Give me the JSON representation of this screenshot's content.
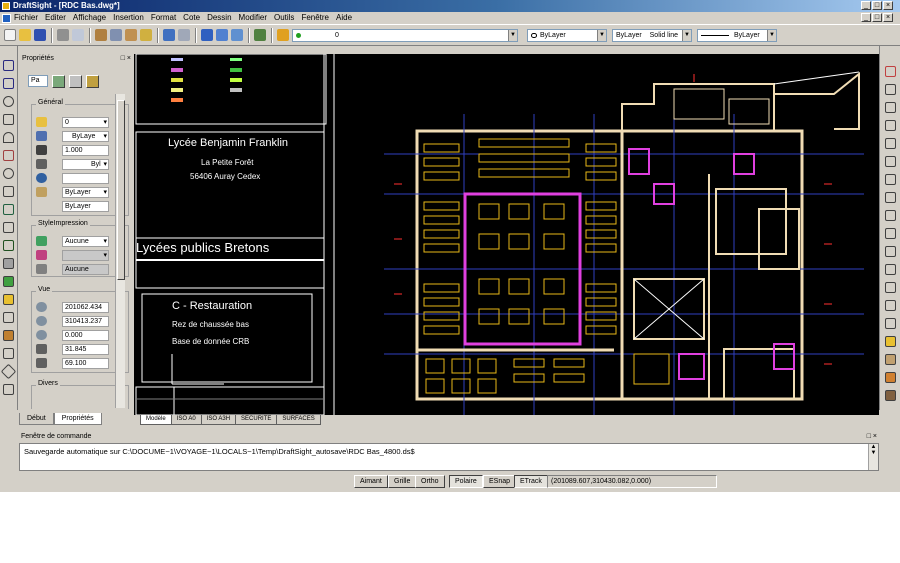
{
  "window": {
    "title": "DraftSight - [RDC Bas.dwg*]",
    "buttons": [
      "_",
      "□",
      "×"
    ],
    "doc_buttons": [
      "_",
      "□",
      "×"
    ]
  },
  "menu": [
    "Fichier",
    "Editer",
    "Affichage",
    "Insertion",
    "Format",
    "Cote",
    "Dessin",
    "Modifier",
    "Outils",
    "Fenêtre",
    "Aide"
  ],
  "toolbar": {
    "layer_value": "0",
    "color_value": "ByLayer",
    "linestyle_value": "ByLayer",
    "linestyle_name": "Solid line",
    "lineweight_value": "ByLayer"
  },
  "properties": {
    "title": "Propriétés",
    "close_btns": "□ ×",
    "select_value": "Pa",
    "general_title": "Général",
    "general": [
      "0",
      "ByLaye",
      "1.000",
      "Byl",
      "",
      "ByLayer",
      "ByLayer"
    ],
    "print_title": "StyleImpression",
    "print": [
      "Aucune",
      "",
      "Aucune"
    ],
    "view_title": "Vue",
    "view": [
      "201062.434",
      "310413.237",
      "0.000",
      "31.845",
      "69.100"
    ],
    "divers_title": "Divers",
    "tabs": [
      "Début",
      "Propriétés"
    ]
  },
  "drawing": {
    "title_block": {
      "school": "Lycée Benjamin Franklin",
      "place": "La Petite Forêt",
      "address": "56406 Auray Cedex",
      "network": "Lycées publics Bretons",
      "section": "C - Restauration",
      "level": "Rez de chaussée bas",
      "database": "Base de donnée CRB"
    },
    "tabs": [
      "Modèle",
      "ISO A0",
      "ISO A3H",
      "SECURITE",
      "SURFACES"
    ]
  },
  "command": {
    "title": "Fenêtre de commande",
    "text": "Sauvegarde automatique sur C:\\DOCUME~1\\VOYAGE~1\\LOCALS~1\\Temp\\DraftSight_autosave\\RDC Bas_4800.ds$",
    "buttons": "□ ×"
  },
  "status": {
    "toggles": [
      "Aimant",
      "Grille",
      "Ortho",
      "Polaire",
      "ESnap",
      "ETrack"
    ],
    "coordinates": "(201089.607,310430.082,0.000)"
  },
  "colors": {
    "title_gradient_start": "#0a246a",
    "wall": "#f0dcb4",
    "partition": "#e040e0",
    "furniture": "#e8b818",
    "grid_line": "#3040c0"
  }
}
